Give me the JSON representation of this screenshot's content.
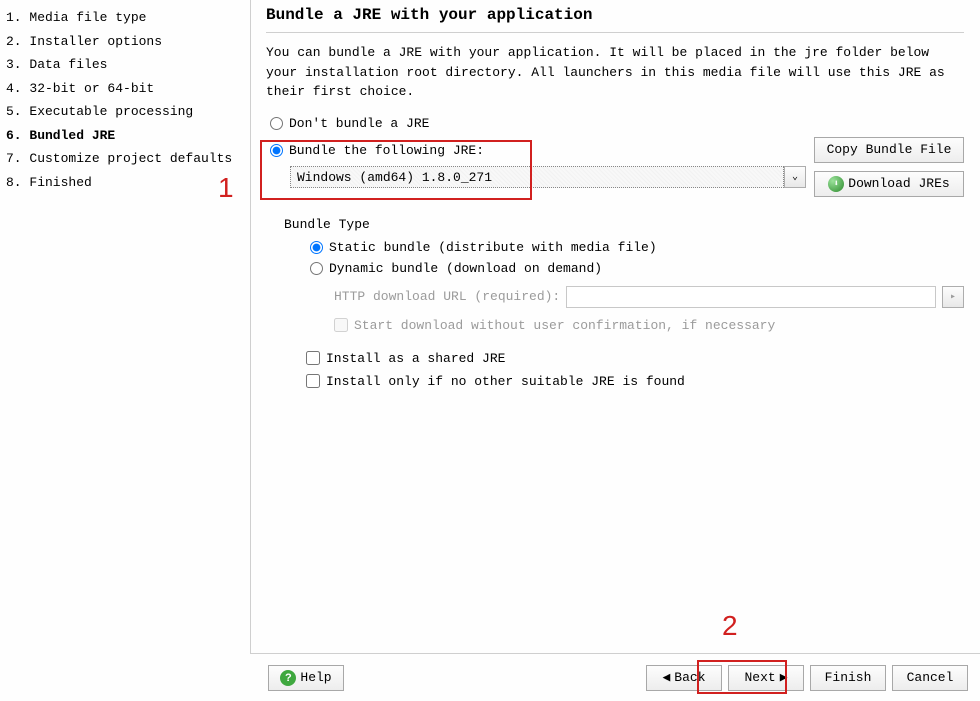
{
  "sidebar": {
    "items": [
      {
        "label": "1. Media file type"
      },
      {
        "label": "2. Installer options"
      },
      {
        "label": "3. Data files"
      },
      {
        "label": "4. 32-bit or 64-bit"
      },
      {
        "label": "5. Executable processing"
      },
      {
        "label": "6. Bundled JRE"
      },
      {
        "label": "7. Customize project defaults"
      },
      {
        "label": "8. Finished"
      }
    ],
    "active_index": 5
  },
  "main": {
    "title": "Bundle a JRE with your application",
    "description": "You can bundle a JRE with your application. It will be placed in the jre folder below your installation root directory. All launchers in this media file will use this JRE as their first choice.",
    "radio_dont_bundle": "Don't bundle a JRE",
    "radio_bundle_following": "Bundle the following JRE:",
    "selected_jre": "Windows (amd64) 1.8.0_271",
    "copy_bundle_btn": "Copy Bundle File",
    "download_jres_btn": "Download JREs",
    "bundle_type_label": "Bundle Type",
    "radio_static": "Static bundle (distribute with media file)",
    "radio_dynamic": "Dynamic bundle (download on demand)",
    "http_label": "HTTP download URL (required):",
    "http_value": "",
    "chk_start_download": "Start download without user confirmation, if necessary",
    "chk_shared": "Install as a shared JRE",
    "chk_only_if": "Install only if no other suitable JRE is found"
  },
  "footer": {
    "help": "Help",
    "back": "Back",
    "next": "Next",
    "finish": "Finish",
    "cancel": "Cancel"
  },
  "annotations": {
    "one": "1",
    "two": "2"
  }
}
